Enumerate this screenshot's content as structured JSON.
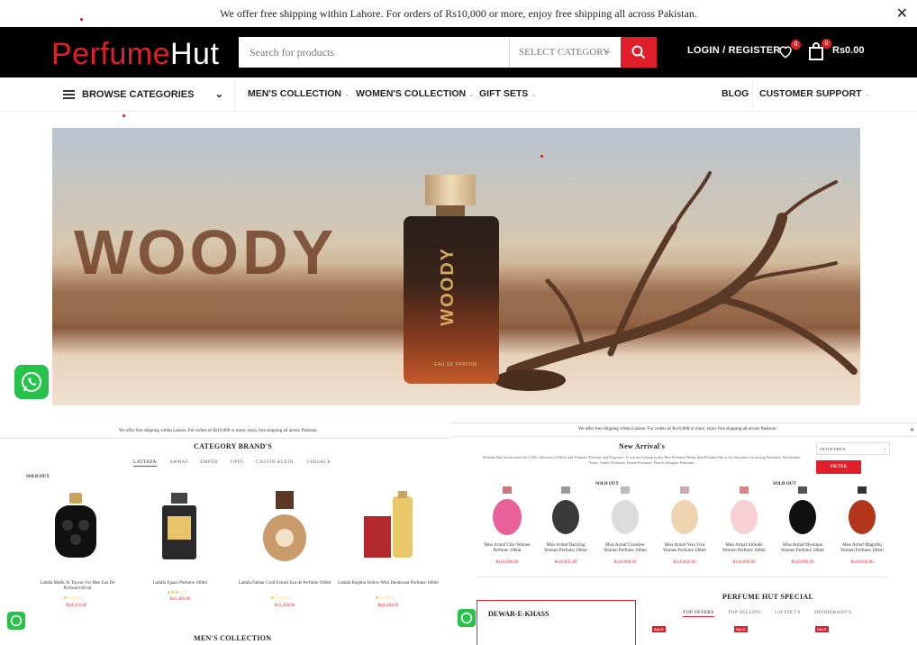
{
  "topbar": {
    "message": "We offer free shipping within Lahore. For orders of Rs10,000 or more, enjoy free shipping all across Pakistan.",
    "close": "✕"
  },
  "header": {
    "logo_part1": "Perfume",
    "logo_part2": "Hut",
    "search_placeholder": "Search for products",
    "category_select": "SELECT CATEGORY",
    "login_label": "LOGIN / REGISTER",
    "wishlist_count": "0",
    "cart_count": "0",
    "cart_total": "Rs0.00"
  },
  "nav": {
    "browse_label": "BROWSE CATEGORIES",
    "items": [
      "MEN'S COLLECTION",
      "WOMEN'S COLLECTION",
      "GIFT SETS",
      "BLOG",
      "CUSTOMER SUPPORT"
    ]
  },
  "hero": {
    "headline": "WOODY",
    "bottle_label": "WOODY",
    "bottle_sub": "EAU DE PARFUM"
  },
  "left_panel": {
    "ship_message": "We offer free shipping within Lahore. For orders of Rs10,000 or more, enjoy free shipping all across Pakistan.",
    "section_title": "CATEGORY BRAND'S",
    "tabs": [
      "LATTAFA",
      "ARMAF",
      "EMPER",
      "OPIO",
      "CALVIN KLEIN",
      "VERSACE"
    ],
    "sold_out": "SOLD OUT",
    "products": [
      {
        "name": "Lattafa Malik Al Tayoor For Men Eau De Perfume100 ml",
        "price": "Rs4,335.00"
      },
      {
        "name": "Lattafa Ejaazi Perfume 100ml",
        "price": "Rs5,405.00"
      },
      {
        "name": "Lattafa Fakhar Gold Extrait Eau de Perfume 100ml",
        "price": "Rs5,560.00"
      },
      {
        "name": "Lattafa Raghba Yellow With Deodorant Perfume 100ml",
        "price": "Rs4,340.00"
      }
    ],
    "next_section": "MEN'S COLLECTION"
  },
  "right_panel": {
    "ship_message": "We offer free shipping within Lahore. For orders of Rs10,000 or more, enjoy free shipping all across Pakistan.",
    "section_title": "New Arrival's",
    "description": "Perfume Hut Stocks more the 2,500 collection of Men's and Women's Perfume and Fragrance. If you are looking to buy Best Perfume Online then Perfume Hut is the best place for buying Perfumes, Deodorants, Attars, Arabic Perfumes, Italian Perfumes, French Designer Perfumes.",
    "filter_select": "FILTER PRICE",
    "filter_button": "FILTER",
    "sold_out": "SOLD OUT",
    "products": [
      {
        "name": "Miss Armaf Chic Women Perfume 100ml",
        "price": "Rs10,500.00"
      },
      {
        "name": "Miss Armaf Dazzling Women Perfume 100ml",
        "price": "Rs10,845.00"
      },
      {
        "name": "Miss Armaf Grandeur Women Perfume 100ml",
        "price": "Rs10,000.00"
      },
      {
        "name": "Miss Armaf Vera Viva Women Perfume 100ml",
        "price": "Rs10,840.00"
      },
      {
        "name": "Miss Armaf Attitude Women Perfume 100ml",
        "price": "Rs10,000.00"
      },
      {
        "name": "Miss Armaf Mystique Women Perfume 100ml",
        "price": "Rs10,990.00"
      },
      {
        "name": "Miss Armaf Magnifiq Women Perfume 100ml",
        "price": "Rs10,040.00"
      }
    ],
    "dewar_title": "DEWAR-E-KHASS",
    "special_title": "PERFUME HUT SPECIAL",
    "special_tabs": [
      "TOP OFFERS",
      "TOP SELLING",
      "GIFTSET'S",
      "DEODORANT'S"
    ],
    "sale": "SALE"
  }
}
